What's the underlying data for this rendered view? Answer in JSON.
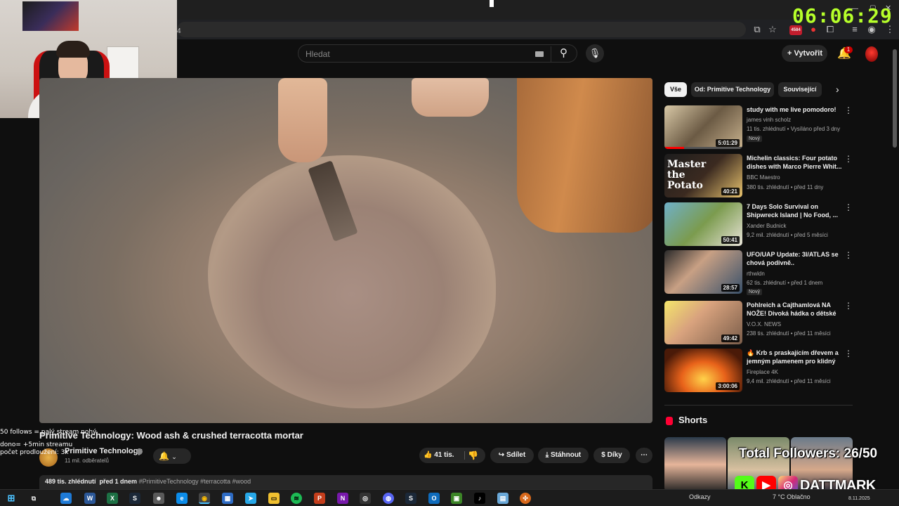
{
  "browser": {
    "address_fragment": "4",
    "extension_badge": "4584"
  },
  "stream_overlay": {
    "clock": "06:06:29",
    "follow_line1": "50 follows = palý stream nohý",
    "follow_line2": "dono= +5min streamu",
    "follow_line3": "počet prodloužení: 3x",
    "followers_text": "Total Followers: 26/50",
    "brand_name": "DATTMARK"
  },
  "header": {
    "search_placeholder": "Hledat",
    "create_label": "Vytvořit",
    "notification_count": "1"
  },
  "video": {
    "title": "Primitive Technology: Wood ash & crushed terracotta mortar",
    "channel_name": "Primitive Technology",
    "subscribers": "11 mil. odběratelů",
    "likes": "41 tis.",
    "share_label": "Sdílet",
    "download_label": "Stáhnout",
    "thanks_label": "Díky",
    "views": "489 tis. zhlédnutí",
    "uploaded": "před 1 dnem",
    "tags": "#PrimitiveTechnology #terracotta #wood"
  },
  "chips": [
    "Vše",
    "Od: Primitive Technology",
    "Související"
  ],
  "recommendations": [
    {
      "title": "study with me live pomodoro!",
      "channel": "james vinh scholz",
      "meta": "11 tis. zhlédnutí • Vysíláno před 3 dny",
      "duration": "5:01:29",
      "badge": "Nový"
    },
    {
      "title": "Michelin classics: Four potato dishes with Marco Pierre Whit...",
      "channel": "BBC Maestro",
      "meta": "380 tis. zhlédnutí • před 11 dny",
      "duration": "40:21",
      "badge": "",
      "thumb_text": "Master the Potato"
    },
    {
      "title": "7 Days Solo Survival on Shipwreck Island | No Food, ...",
      "channel": "Xander Budnick",
      "meta": "9,2 mil. zhlédnutí • před 5 měsíci",
      "duration": "50:41",
      "badge": ""
    },
    {
      "title": "UFO/UAP Update: 3I/ATLAS se chová podivně..",
      "channel": "rthwldn",
      "meta": "62 tis. zhlédnutí • před 1 dnem",
      "duration": "28:57",
      "badge": "Nový"
    },
    {
      "title": "Pohlreich a Cajthamlová NA NOŽE! Divoká hádka o dětské ...",
      "channel": "V.O.X. NEWS",
      "meta": "238 tis. zhlédnutí • před 11 měsíci",
      "duration": "49:42",
      "badge": ""
    },
    {
      "title": "🔥 Krb s praskajícím dřevem a jemným plamenem pro klidný ...",
      "channel": "Fireplace 4K",
      "meta": "9,4 mil. zhlédnutí • před 11 měsíci",
      "duration": "3:00:06",
      "badge": ""
    }
  ],
  "shorts": {
    "title": "Shorts"
  },
  "taskbar": {
    "links_label": "Odkazy",
    "weather": "7 °C Oblačno",
    "date": "8.11.2025"
  },
  "colors": {
    "background": "#0f0f0f",
    "accent_red": "#ff0033",
    "clock_green": "#b6ff2a"
  }
}
